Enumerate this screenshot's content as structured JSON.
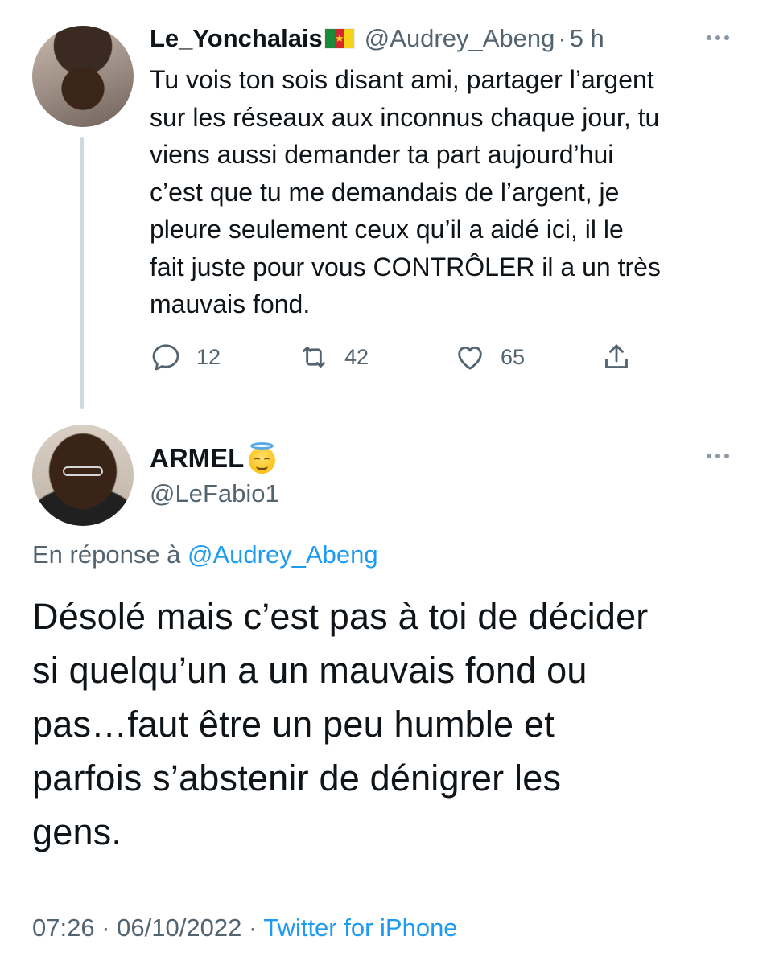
{
  "parent_tweet": {
    "display_name": "Le_Yonchalais",
    "handle": "@Audrey_Abeng",
    "separator": "·",
    "time": "5 h",
    "text": "Tu vois ton sois disant ami, partager l’argent\nsur les réseaux aux inconnus chaque jour, tu\nviens aussi demander ta part aujourd’hui\nc’est que tu me demandais de l’argent, je\npleure seulement ceux qu’il a aidé ici, il le\nfait juste pour vous CONTRÔLER il a un très\nmauvais fond.",
    "replies": "12",
    "retweets": "42",
    "likes": "65",
    "name_flag_icon": "cameroon-flag-icon"
  },
  "main_tweet": {
    "display_name": "ARMEL",
    "name_emoji_icon": "smiling-face-with-halo-icon",
    "handle": "@LeFabio1",
    "reply_prefix": "En réponse à ",
    "reply_to": "@Audrey_Abeng",
    "text": "Désolé mais c’est pas à toi de décider\nsi quelqu’un a un mauvais fond ou\npas…faut être un peu humble et\nparfois s’abstenir de dénigrer les\ngens.",
    "time": "07:26",
    "separator": "·",
    "date": "06/10/2022",
    "source": "Twitter for iPhone"
  },
  "colors": {
    "text": "#0f1419",
    "muted": "#536471",
    "link": "#1d9bf0",
    "thread_line": "#cfd9de"
  }
}
